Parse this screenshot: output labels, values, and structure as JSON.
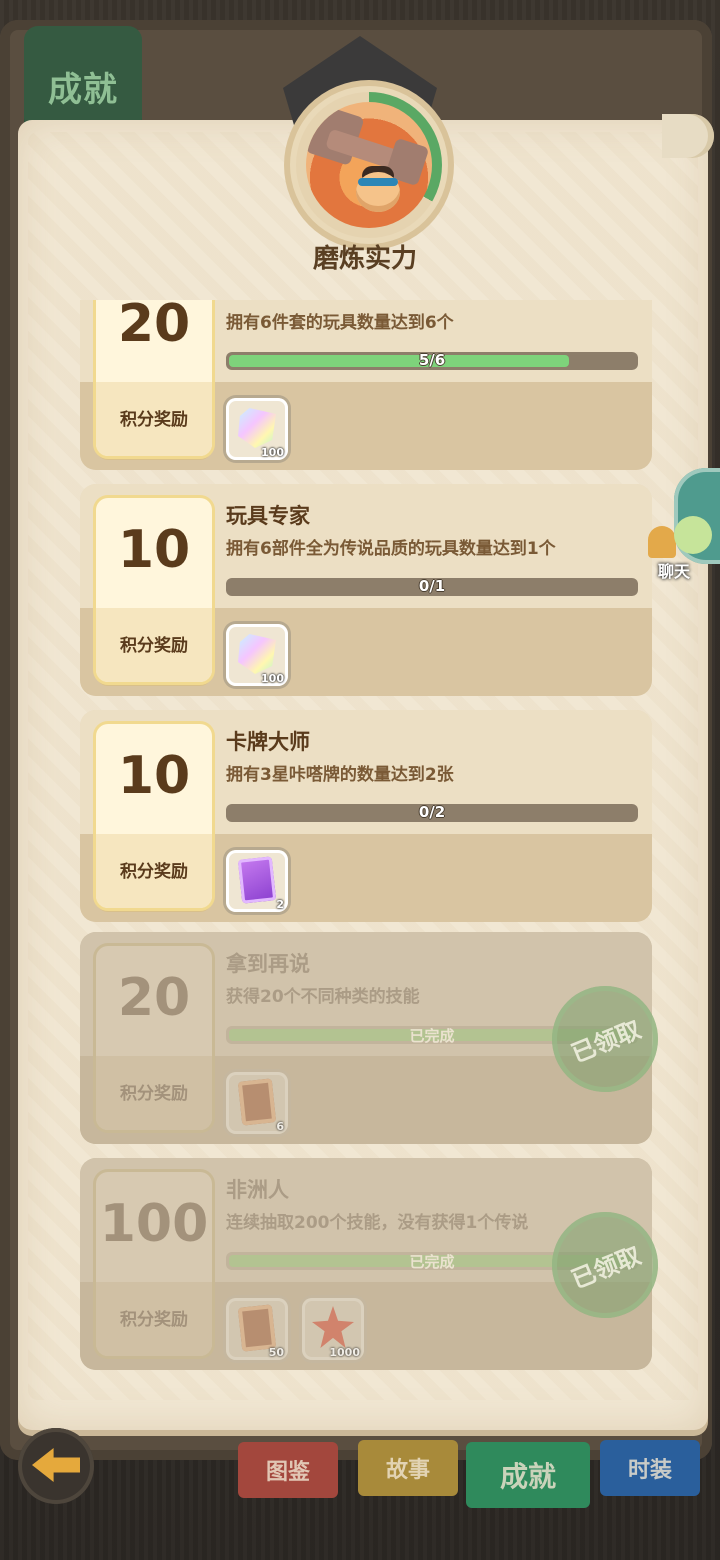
{
  "page_tab": "成就",
  "header": {
    "title": "磨炼实力",
    "progress_color": "#5aa864"
  },
  "achievements": [
    {
      "points": "20",
      "points_label": "积分奖励",
      "title": "",
      "desc": "拥有6件套的玩具数量达到6个",
      "progress_text": "5/6",
      "progress_fraction": 0.833,
      "rewards": [
        {
          "icon": "gem-icon",
          "count": "100"
        }
      ],
      "status": "in-progress"
    },
    {
      "points": "10",
      "points_label": "积分奖励",
      "title": "玩具专家",
      "desc": "拥有6部件全为传说品质的玩具数量达到1个",
      "progress_text": "0/1",
      "progress_fraction": 0,
      "rewards": [
        {
          "icon": "gem-icon",
          "count": "100"
        }
      ],
      "status": "in-progress"
    },
    {
      "points": "10",
      "points_label": "积分奖励",
      "title": "卡牌大师",
      "desc": "拥有3星咔嗒牌的数量达到2张",
      "progress_text": "0/2",
      "progress_fraction": 0,
      "rewards": [
        {
          "icon": "card-icon",
          "count": "2"
        }
      ],
      "status": "in-progress"
    },
    {
      "points": "20",
      "points_label": "积分奖励",
      "title": "拿到再说",
      "desc": "获得20个不同种类的技能",
      "progress_text": "已完成",
      "progress_fraction": 1,
      "rewards": [
        {
          "icon": "skill-scroll-icon",
          "count": "6"
        }
      ],
      "status": "claimed",
      "stamp": "已领取"
    },
    {
      "points": "100",
      "points_label": "积分奖励",
      "title": "非洲人",
      "desc": "连续抽取200个技能，没有获得1个传说",
      "progress_text": "已完成",
      "progress_fraction": 1,
      "rewards": [
        {
          "icon": "skill-scroll-icon",
          "count": "50"
        },
        {
          "icon": "starfish-icon",
          "count": "1000"
        }
      ],
      "status": "claimed",
      "stamp": "已领取"
    }
  ],
  "chat": {
    "label": "聊天"
  },
  "bottom_tabs": [
    {
      "label": "图鉴",
      "color": "#a3473d"
    },
    {
      "label": "故事",
      "color": "#a88a3a"
    },
    {
      "label": "成就",
      "color": "#2f8a5c",
      "active": true
    },
    {
      "label": "时装",
      "color": "#2a5f9c"
    }
  ]
}
